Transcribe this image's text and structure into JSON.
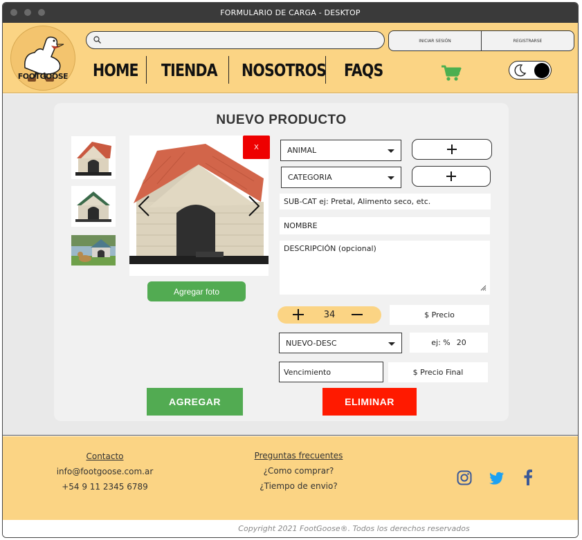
{
  "window": {
    "title": "FORMULARIO DE CARGA - DESKTOP"
  },
  "brand": {
    "logo_text": "FOOTGOOSE"
  },
  "search": {
    "placeholder": "",
    "value": ""
  },
  "auth": {
    "login_label": "INICIAR SESIÓN",
    "register_label": "REGISTRARSE"
  },
  "nav": {
    "items": [
      "HOME",
      "TIENDA",
      "NOSOTROS",
      "FAQS"
    ]
  },
  "colors": {
    "header": "#fbd484",
    "cart": "#4caf50",
    "add": "#52ab52",
    "delete": "#ff1a00",
    "remove": "#ee0000",
    "social": "#3b5998",
    "twitter": "#1da1f2"
  },
  "icons": [
    "search-icon",
    "cart-icon",
    "moon-icon",
    "chevron-left-icon",
    "chevron-right-icon",
    "plus-icon",
    "minus-icon",
    "resize-icon",
    "instagram-icon",
    "twitter-icon",
    "facebook-icon"
  ],
  "form": {
    "title": "NUEVO PRODUCTO",
    "remove_photo_label": "X",
    "add_photo_label": "Agregar foto",
    "animal_select": "ANIMAL",
    "category_select": "CATEGORIA",
    "subcat_placeholder": "SUB-CAT ej: Pretal, Alimento seco, etc.",
    "name_placeholder": "NOMBRE",
    "description_placeholder": "DESCRIPCIÓN (opcional)",
    "quantity": "34",
    "price_placeholder": "$ Precio",
    "discount_select": "NUEVO-DESC",
    "discount_prefix": "ej: %",
    "discount_value": "20",
    "expiry_placeholder": "Vencimiento",
    "final_price_placeholder": "$ Precio Final",
    "add_button": "AGREGAR",
    "delete_button": "ELIMINAR"
  },
  "footer": {
    "contact_title": "Contacto",
    "email": "info@footgoose.com.ar",
    "phone": "+54 9 11 2345 6789",
    "faq_title": "Preguntas frecuentes",
    "faq_1": "¿Como comprar?",
    "faq_2": "¿Tiempo de envio?",
    "copyright": "Copyright 2021 FootGoose®. Todos los derechos reservados"
  }
}
